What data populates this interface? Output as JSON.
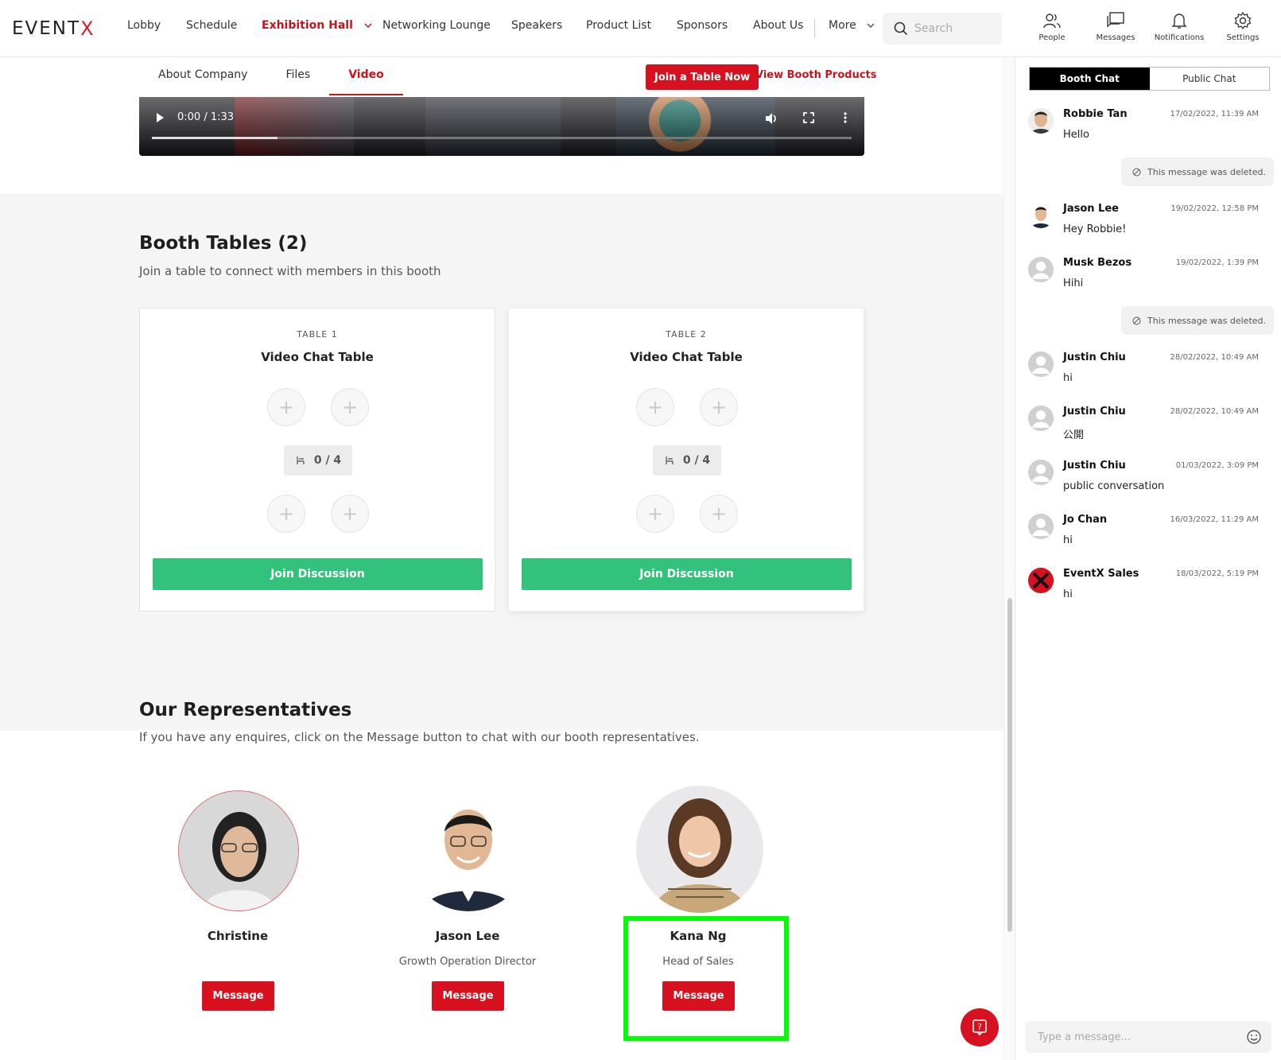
{
  "app": {
    "logo_text": "EVENT",
    "logo_x": "X"
  },
  "nav": {
    "items": [
      "Lobby",
      "Schedule",
      "Exhibition Hall",
      "Networking Lounge",
      "Speakers",
      "Product List",
      "Sponsors",
      "About Us",
      "More"
    ],
    "active": "Exhibition Hall",
    "search_placeholder": "Search",
    "icons": [
      {
        "icon": "people-icon",
        "label": "People"
      },
      {
        "icon": "messages-icon",
        "label": "Messages"
      },
      {
        "icon": "bell-icon",
        "label": "Notifications"
      },
      {
        "icon": "gear-icon",
        "label": "Settings"
      }
    ]
  },
  "booth_tabs": {
    "items": [
      "About Company",
      "Files",
      "Video"
    ],
    "active": "Video",
    "join_table_label": "Join a Table Now",
    "view_products_label": "View Booth Products"
  },
  "video": {
    "time": "0:00 / 1:33",
    "progress": 0.18
  },
  "tables_section": {
    "title": "Booth Tables (2)",
    "subtitle": "Join a table to connect with members in this booth",
    "tables": [
      {
        "number": "TABLE 1",
        "name": "Video Chat Table",
        "capacity": "0 / 4",
        "join_label": "Join Discussion"
      },
      {
        "number": "TABLE 2",
        "name": "Video Chat Table",
        "capacity": "0 / 4",
        "join_label": "Join Discussion"
      }
    ]
  },
  "reps_section": {
    "title": "Our Representatives",
    "subtitle": "If you have any enquires, click on the Message button to chat with our booth representatives.",
    "reps": [
      {
        "name": "Christine",
        "role": "",
        "button": "Message"
      },
      {
        "name": "Jason Lee",
        "role": "Growth Operation Director",
        "button": "Message"
      },
      {
        "name": "Kana Ng",
        "role": "Head of Sales",
        "button": "Message"
      }
    ]
  },
  "chat": {
    "tabs": [
      "Booth Chat",
      "Public Chat"
    ],
    "active_tab": "Booth Chat",
    "deleted_text": "This message was deleted.",
    "messages": [
      {
        "name": "Robbie Tan",
        "time": "17/02/2022, 11:39 AM",
        "text": "Hello"
      },
      {
        "name": "Jason Lee",
        "time": "19/02/2022, 12:58 PM",
        "text": "Hey Robbie!"
      },
      {
        "name": "Musk Bezos",
        "time": "19/02/2022, 1:39 PM",
        "text": "Hihi"
      },
      {
        "name": "Justin Chiu",
        "time": "28/02/2022, 10:49 AM",
        "text": "hi"
      },
      {
        "name": "Justin Chiu",
        "time": "28/02/2022, 10:49 AM",
        "text": "公開"
      },
      {
        "name": "Justin Chiu",
        "time": "01/03/2022, 3:09 PM",
        "text": "public conversation"
      },
      {
        "name": "Jo Chan",
        "time": "16/03/2022, 11:29 AM",
        "text": "hi"
      },
      {
        "name": "EventX Sales",
        "time": "18/03/2022, 5:19 PM",
        "text": "hi"
      }
    ],
    "input_placeholder": "Type a message..."
  },
  "colors": {
    "brand_red": "#d7111f",
    "join_green": "#33c27b",
    "highlight": "#00ff00"
  }
}
